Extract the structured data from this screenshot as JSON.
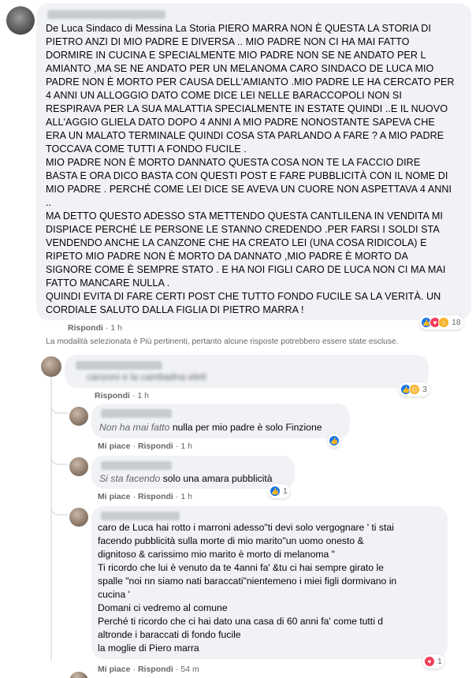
{
  "main_comment": {
    "lines": [
      "De Luca Sindaco di Messina La Storia PIERO MARRA NON È QUESTA LA STORIA DI",
      "PIETRO ANZI DI MIO PADRE E DIVERSA .. MIO PADRE NON CI HA MAI FATTO",
      "DORMIRE IN CUCINA E SPECIALMENTE MIO PADRE NON SE NE ANDATO PER L",
      "AMIANTO ,MA SE NE ANDATO PER UN MELANOMA CARO SINDACO DE LUCA MIO",
      "PADRE NON È MORTO PER CAUSA DELL'AMIANTO .MIO PADRE LE HA CERCATO PER",
      "4 ANNI UN ALLOGGIO DATO COME DICE LEI NELLE BARACCOPOLI NON SI",
      "RESPIRAVA PER LA SUA MALATTIA SPECIALMENTE IN ESTATE QUINDI ..E IL NUOVO",
      "ALL'AGGIO GLIELA DATO DOPO 4 ANNI A MIO PADRE NONOSTANTE SAPEVA CHE",
      "ERA UN MALATO TERMINALE QUINDI COSA STA PARLANDO A FARE ? A MIO PADRE",
      "TOCCAVA COME TUTTI A FONDO FUCILE .",
      "MIO PADRE NON È MORTO DANNATO QUESTA COSA NON TE LA FACCIO DIRE",
      "BASTA E ORA DICO BASTA CON QUESTI POST E FARE PUBBLICITÀ CON IL NOME DI",
      "MIO PADRE . PERCHÉ COME LEI DICE SE AVEVA UN CUORE NON ASPETTAVA 4 ANNI",
      "..",
      "MA DETTO QUESTO ADESSO STA METTENDO QUESTA CANTLILENA IN VENDITA MI",
      "DISPIACE PERCHÉ LE PERSONE LE STANNO CREDENDO .PER FARSI I SOLDI STA",
      "VENDENDO ANCHE LA CANZONE CHE HA CREATO LEI (UNA COSA RIDICOLA) E",
      "RIPETO MIO PADRE NON È MORTO DA DANNATO ,MIO PADRE È MORTO DA",
      "SIGNORE COME È SEMPRE STATO . E HA NOI FIGLI CARO DE LUCA NON CI MA MAI",
      "FATTO MANCARE NULLA .",
      "QUINDI EVITA DI FARE CERTI POST CHE TUTTO FONDO FUCILE SA LA VERITÀ. UN",
      "CORDIALE SALUTO DALLA FIGLIA DI PIETRO MARRA !"
    ],
    "reply_label": "Rispondi",
    "time": "1 h",
    "reaction_count": "18"
  },
  "notice": "La modalità selezionata è Più pertinenti, pertanto alcune risposte potrebbero essere state escluse.",
  "reply1": {
    "text_blurred": "canzoni e la cambadna elett",
    "reply_label": "Rispondi",
    "time": "1 h",
    "reaction_count": "3"
  },
  "reply2": {
    "text_lead": "Non ha mai fatto",
    "text": " nulla per mio padre è solo Finzione",
    "like_label": "Mi piace",
    "reply_label": "Rispondi",
    "time": "1 h"
  },
  "reply3": {
    "text_lead": "Si sta facendo",
    "text": " solo una amara pubblicità",
    "like_label": "Mi piace",
    "reply_label": "Rispondi",
    "time": "1 h",
    "reaction_count": "1"
  },
  "reply4": {
    "lines": [
      "caro de Luca hai rotto i marroni adesso\"ti devi solo vergognare ' ti stai",
      "facendo pubblicità sulla morte di mio marito\"un uomo onesto &",
      "dignitoso & carissimo mio marito è morto di melanoma \"",
      "Ti ricordo che lui è venuto da te 4anni fa' &tu ci hai sempre girato le",
      "spalle \"noi nn siamo nati baraccati\"nientemeno i miei figli dormivano in",
      "cucina '",
      "Domani ci vedremo al comune",
      "Perché ti ricordo che ci hai dato una casa di 60 anni fa' come tutti d",
      "altronde i baraccati di fondo fucile",
      "la moglie di Piero marra"
    ],
    "like_label": "Mi piace",
    "reply_label": "Rispondi",
    "time": "54 m",
    "reaction_count": "1"
  },
  "icons": [
    "like-icon",
    "love-icon",
    "haha-icon",
    "sad-icon"
  ],
  "colors": {
    "bubble": "#f0f2f5",
    "meta": "#65676b",
    "like": "#1877f2",
    "love": "#f33e58"
  }
}
